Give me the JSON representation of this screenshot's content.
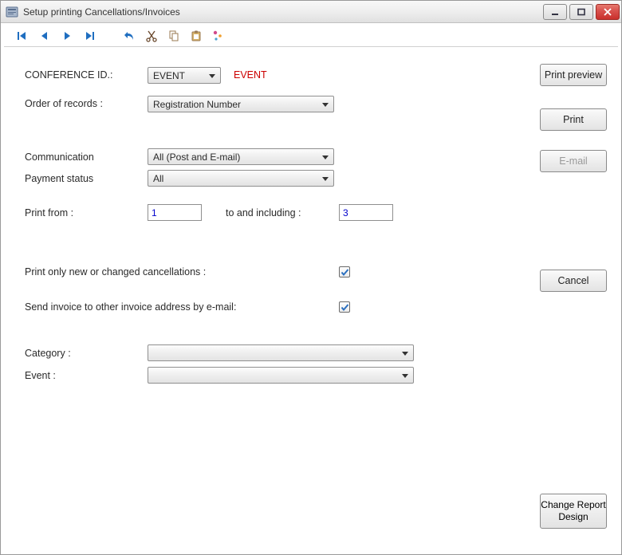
{
  "window": {
    "title": "Setup printing Cancellations/Invoices"
  },
  "form": {
    "conference_label": "CONFERENCE ID.:",
    "conference_value": "EVENT",
    "conference_side": "EVENT",
    "order_label": "Order of records :",
    "order_value": "Registration Number",
    "communication_label": "Communication",
    "communication_value": "All (Post and E-mail)",
    "payment_label": "Payment status",
    "payment_value": "All",
    "print_from_label": "Print from :",
    "print_from_value": "1",
    "to_including_label": "to and including :",
    "to_including_value": "3",
    "only_new_label": "Print only new or changed cancellations :",
    "only_new_checked": true,
    "send_invoice_label": "Send invoice to other invoice address by e-mail:",
    "send_invoice_checked": true,
    "category_label": "Category :",
    "category_value": "",
    "event_label": "Event :",
    "event_value": ""
  },
  "buttons": {
    "print_preview": "Print preview",
    "print": "Print",
    "email": "E-mail",
    "cancel": "Cancel",
    "change_report": "Change Report Design"
  }
}
